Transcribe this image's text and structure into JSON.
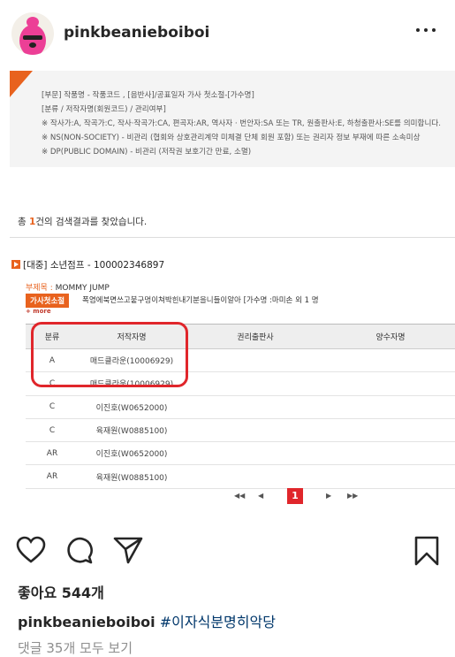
{
  "header": {
    "username": "pinkbeanieboiboi"
  },
  "infobox": {
    "lines": [
      "[부문] 작품명 - 작품코드 , [음반사]/공표일자 가사 첫소절-[가수명]",
      "[분류 / 저작자명(회원코드) / 관리여부]",
      "※ 작사가:A, 작곡가:C, 작사·작곡가:CA, 편곡자:AR, 역사자 · 번안자:SA 또는 TR, 원출판사:E, 하청출판사:SE를 의미합니다.",
      "※ NS(NON-SOCIETY) - 비관리 (협회와 상호관리계약 미체결 단체 회원 포함) 또는 권리자 정보 부재에 따른 소속미상",
      "※ DP(PUBLIC DOMAIN) - 비관리 (저작권 보호기간 만료, 소멸)"
    ]
  },
  "result": {
    "prefix": "총 ",
    "count": "1",
    "suffix": "건의 검색결과를 찾았습니다."
  },
  "work": {
    "title": "[대중] 소년점프 - 100002346897",
    "subtitle_label": "부제목 : ",
    "subtitle": "MOMMY JUMP",
    "badge": "가사첫소절",
    "lyric": "폭염에북면쓰고붙구멍이쳐박힌내기분을니들이알아 [가수명 :마미손 외 1 명",
    "more": "+ more"
  },
  "table": {
    "headers": [
      "분류",
      "저작자명",
      "권리출판사",
      "양수자명"
    ],
    "rows": [
      [
        "A",
        "매드클라운(10006929)",
        "",
        ""
      ],
      [
        "C",
        "매드클라운(10006929)",
        "",
        ""
      ],
      [
        "C",
        "이진호(W0652000)",
        "",
        ""
      ],
      [
        "C",
        "육재원(W0885100)",
        "",
        ""
      ],
      [
        "AR",
        "이진호(W0652000)",
        "",
        ""
      ],
      [
        "AR",
        "육재원(W0885100)",
        "",
        ""
      ]
    ]
  },
  "pager": {
    "current": "1",
    "first": "◀◀",
    "prev": "◀",
    "next": "▶",
    "last": "▶▶"
  },
  "footer": {
    "likes": "좋아요 544개",
    "caption_user": "pinkbeanieboiboi",
    "caption_tag": "#이자식분명히악당",
    "comments": "댓글 35개 모두 보기"
  },
  "colors": {
    "accent": "#e8621e",
    "highlight": "#e0262b",
    "avatar_pink": "#ec3f96"
  }
}
